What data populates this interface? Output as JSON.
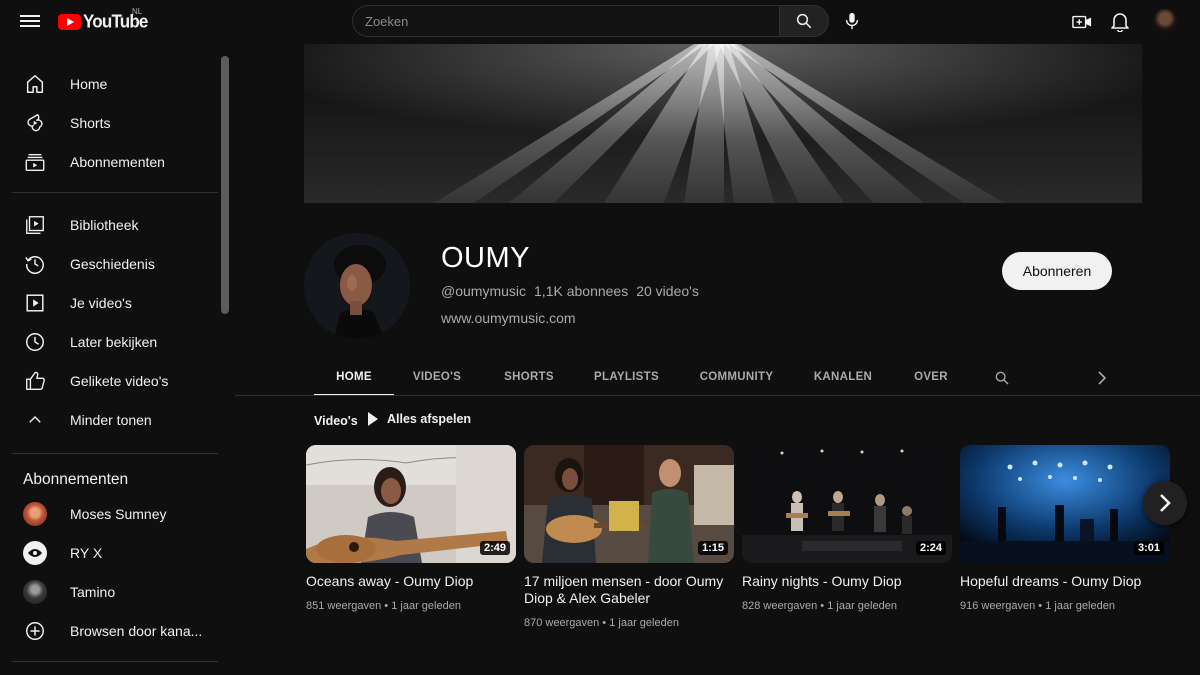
{
  "header": {
    "logo_text": "YouTube",
    "region": "NL",
    "search_placeholder": "Zoeken",
    "accent": "#ff0000"
  },
  "sidebar": {
    "main_items": [
      {
        "label": "Home",
        "icon": "home-icon"
      },
      {
        "label": "Shorts",
        "icon": "shorts-icon"
      },
      {
        "label": "Abonnementen",
        "icon": "subscriptions-icon"
      }
    ],
    "library_items": [
      {
        "label": "Bibliotheek",
        "icon": "library-icon"
      },
      {
        "label": "Geschiedenis",
        "icon": "history-icon"
      },
      {
        "label": "Je video's",
        "icon": "your-videos-icon"
      },
      {
        "label": "Later bekijken",
        "icon": "watch-later-icon"
      },
      {
        "label": "Gelikete video's",
        "icon": "liked-icon"
      },
      {
        "label": "Minder tonen",
        "icon": "chevron-up-icon"
      }
    ],
    "subscriptions_title": "Abonnementen",
    "subscriptions": [
      {
        "label": "Moses Sumney",
        "color": "#c0553a"
      },
      {
        "label": "RY X",
        "color": "#f1f1f1"
      },
      {
        "label": "Tamino",
        "color": "#555555"
      }
    ],
    "browse_label": "Browsen door kana..."
  },
  "channel": {
    "name": "OUMY",
    "handle": "@oumymusic",
    "subscribers": "1,1K abonnees",
    "videos_count": "20 video's",
    "link": "www.oumymusic.com",
    "subscribe_label": "Abonneren"
  },
  "tabs": [
    "HOME",
    "VIDEO'S",
    "SHORTS",
    "PLAYLISTS",
    "COMMUNITY",
    "KANALEN",
    "OVER"
  ],
  "active_tab": "HOME",
  "section": {
    "label": "Video's",
    "play_all": "Alles afspelen"
  },
  "videos": [
    {
      "title": "Oceans away - Oumy Diop",
      "duration": "2:49",
      "views": "851 weergaven",
      "age": "1 jaar geleden"
    },
    {
      "title": "17 miljoen mensen - door Oumy Diop & Alex Gabeler",
      "duration": "1:15",
      "views": "870 weergaven",
      "age": "1 jaar geleden"
    },
    {
      "title": "Rainy nights - Oumy Diop",
      "duration": "2:24",
      "views": "828 weergaven",
      "age": "1 jaar geleden"
    },
    {
      "title": "Hopeful dreams - Oumy Diop",
      "duration": "3:01",
      "views": "916 weergaven",
      "age": "1 jaar geleden"
    }
  ]
}
